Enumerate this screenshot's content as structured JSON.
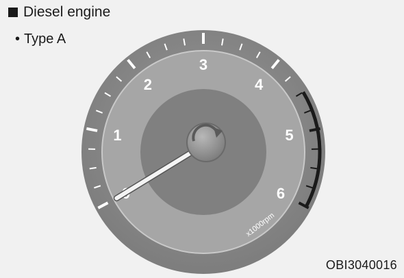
{
  "heading": {
    "text": "Diesel engine"
  },
  "subheading": {
    "bullet": "•",
    "text": "Type A"
  },
  "figure_code": "OBI3040016",
  "gauge": {
    "scale_labels": [
      "0",
      "1",
      "2",
      "3",
      "4",
      "5",
      "6"
    ],
    "unit_label": "x1000rpm",
    "needle_value": 0,
    "redline_start": 4.5
  },
  "colors": {
    "panel": "#f1f1f1",
    "outer_ring": "#8a8a8a",
    "face": "#a6a6a6",
    "inner_disc": "#808080",
    "redzone": "#1a1a1a",
    "ticks": "#ffffff"
  }
}
